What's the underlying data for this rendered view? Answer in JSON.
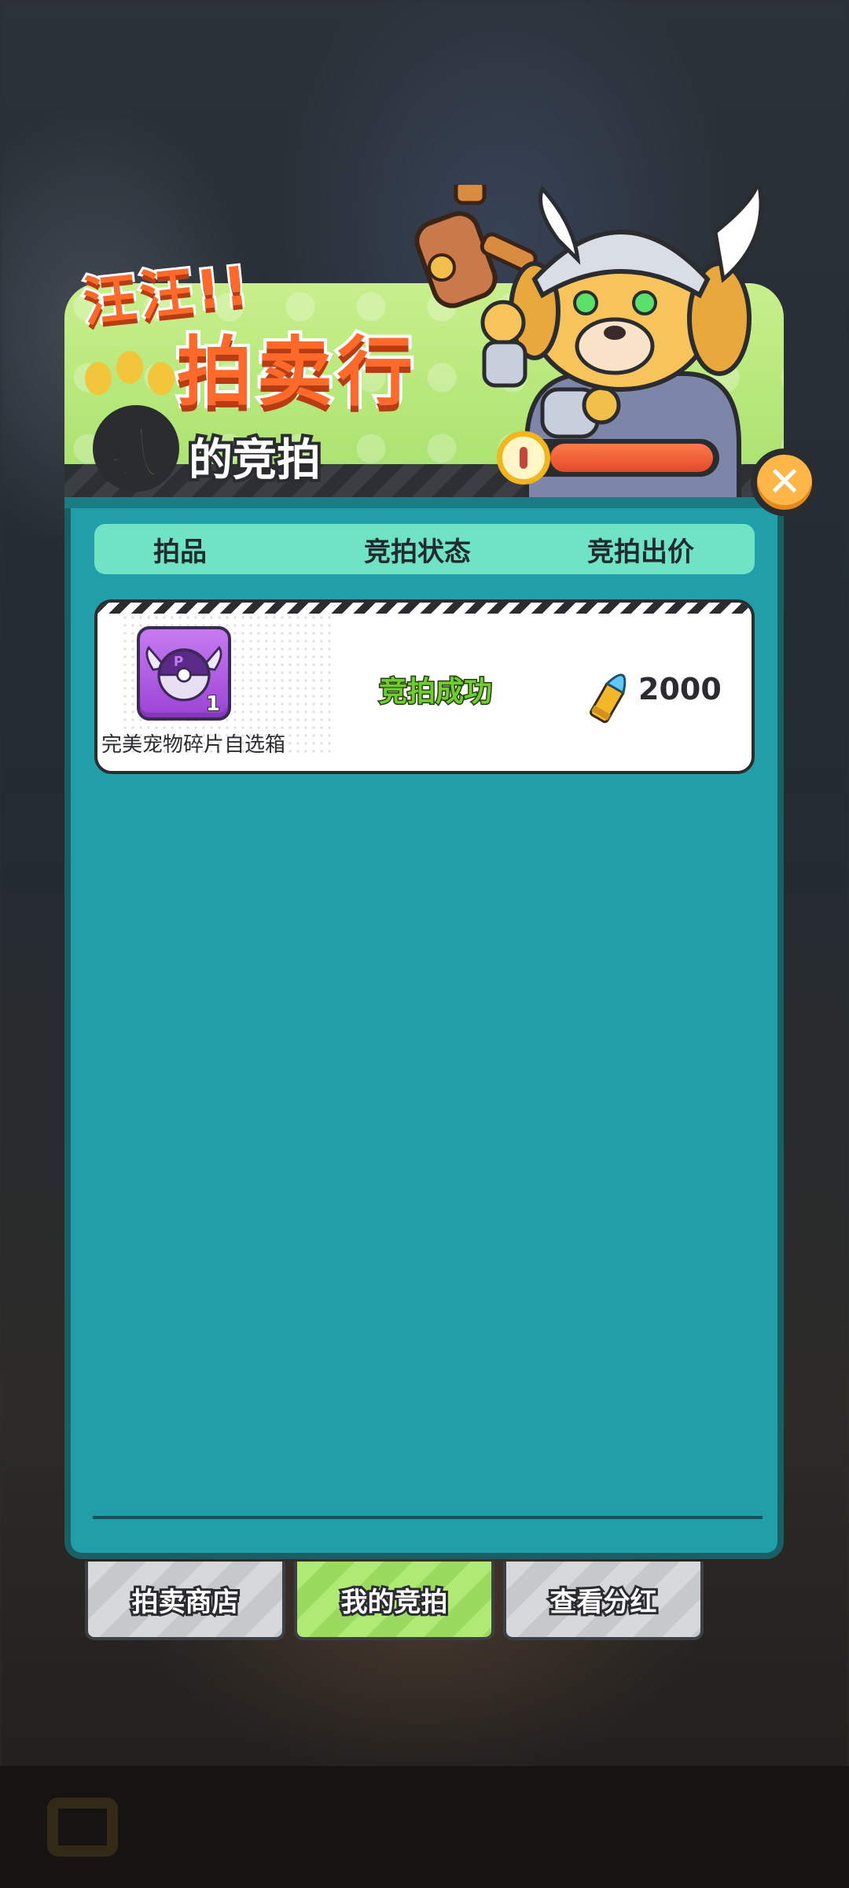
{
  "header": {
    "title_small": "汪汪!!",
    "title_big": "拍卖行",
    "me_badge": "我",
    "subtitle": "的竞拍",
    "progress_percent": 100
  },
  "table": {
    "columns": [
      "拍品",
      "竞拍状态",
      "竞拍出价"
    ]
  },
  "items": [
    {
      "name": "完美宠物碎片自选箱",
      "quantity": "1",
      "status": "竞拍成功",
      "price": "2000",
      "icon": "pet-shard-box-icon",
      "currency_icon": "bullet-icon"
    }
  ],
  "tabs": [
    "拍卖商店",
    "我的竞拍",
    "查看分红"
  ],
  "active_tab": "我的竞拍",
  "colors": {
    "panel": "#219ea7",
    "header_row": "#6fe3c4",
    "status_success": "#6ccf2c",
    "title_orange": "#ff6a2a",
    "close_button": "#ffb648"
  }
}
